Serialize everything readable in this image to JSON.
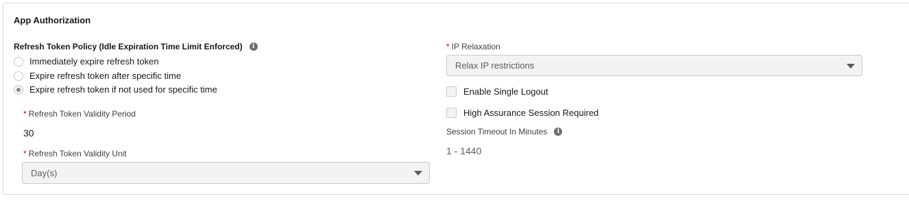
{
  "section": {
    "title": "App Authorization"
  },
  "refresh_policy": {
    "label": "Refresh Token Policy (Idle Expiration Time Limit Enforced)",
    "info_icon": "info-icon",
    "options": [
      {
        "label": "Immediately expire refresh token",
        "checked": false
      },
      {
        "label": "Expire refresh token after specific time",
        "checked": false
      },
      {
        "label": "Expire refresh token if not used for specific time",
        "checked": true
      }
    ]
  },
  "validity_period": {
    "required_marker": "*",
    "label": "Refresh Token Validity Period",
    "value": "30"
  },
  "validity_unit": {
    "required_marker": "*",
    "label": "Refresh Token Validity Unit",
    "selected": "Day(s)"
  },
  "ip_relaxation": {
    "required_marker": "*",
    "label": "IP Relaxation",
    "selected": "Relax IP restrictions"
  },
  "checkboxes": {
    "single_logout": {
      "label": "Enable Single Logout",
      "checked": false
    },
    "high_assurance": {
      "label": "High Assurance Session Required",
      "checked": false
    }
  },
  "session_timeout": {
    "label": "Session Timeout In Minutes",
    "info_icon": "info-icon",
    "placeholder": "1 - 1440"
  },
  "colors": {
    "required": "#ba0517",
    "border": "#d9d9d9",
    "disabled_bg": "#f3f3f3"
  }
}
